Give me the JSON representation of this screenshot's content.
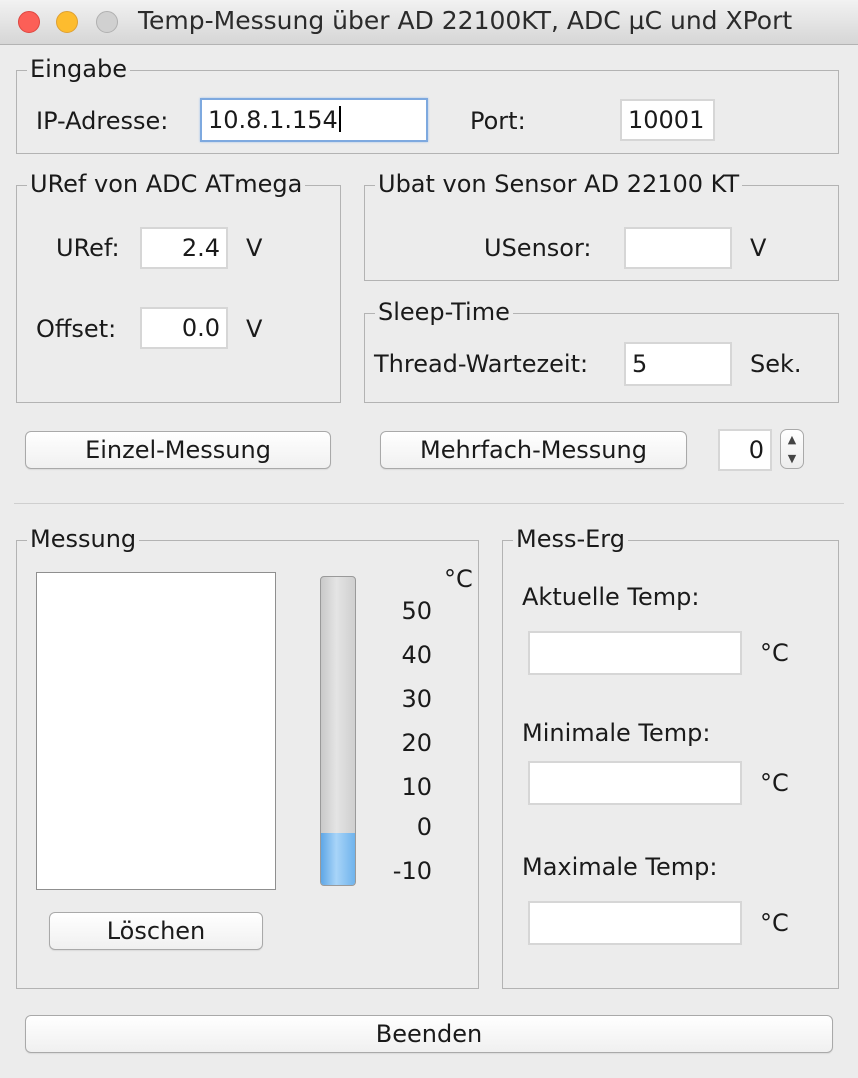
{
  "window": {
    "title": "Temp-Messung über AD 22100KT, ADC µC und XPort"
  },
  "eingabe": {
    "legend": "Eingabe",
    "ip_label": "IP-Adresse:",
    "ip_value": "10.8.1.154",
    "port_label": "Port:",
    "port_value": "10001"
  },
  "uref": {
    "legend": "URef von ADC ATmega",
    "uref_label": "URef:",
    "uref_value": "2.4",
    "uref_unit": "V",
    "offset_label": "Offset:",
    "offset_value": "0.0",
    "offset_unit": "V"
  },
  "ubat": {
    "legend": "Ubat von Sensor AD 22100 KT",
    "usensor_label": "USensor:",
    "usensor_value": "",
    "usensor_unit": "V"
  },
  "sleep": {
    "legend": "Sleep-Time",
    "label": "Thread-Wartezeit:",
    "value": "5",
    "unit": "Sek."
  },
  "buttons": {
    "einzel": "Einzel-Messung",
    "mehrfach": "Mehrfach-Messung",
    "count_value": "0",
    "loeschen": "Löschen",
    "beenden": "Beenden"
  },
  "messung": {
    "legend": "Messung",
    "unit": "°C",
    "ticks": [
      "50",
      "40",
      "30",
      "20",
      "10",
      "0",
      "-10"
    ],
    "level_fraction": 0.17
  },
  "ergebnis": {
    "legend": "Mess-Erg",
    "aktuelle_label": "Aktuelle Temp:",
    "aktuelle_value": "",
    "minimale_label": "Minimale Temp:",
    "minimale_value": "",
    "maximale_label": "Maximale Temp:",
    "maximale_value": "",
    "unit": "°C"
  },
  "colors": {
    "focus_border": "#7ea9df",
    "thermo_fill": "#6fb3ec",
    "close": "#fc5f57",
    "minimize": "#fdbc2e"
  },
  "icons": {
    "spinner_up": "arrow-up-icon",
    "spinner_down": "arrow-down-icon"
  }
}
